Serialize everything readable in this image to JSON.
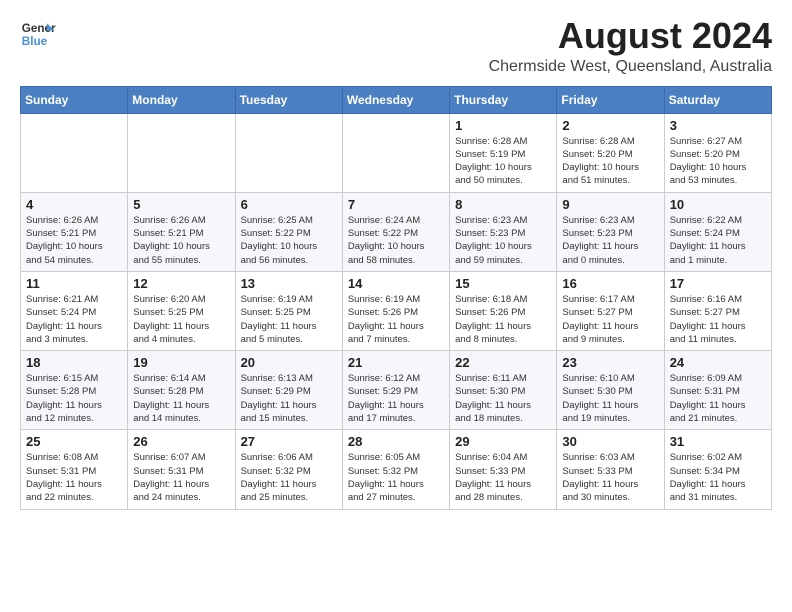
{
  "logo": {
    "line1": "General",
    "line2": "Blue"
  },
  "title": "August 2024",
  "subtitle": "Chermside West, Queensland, Australia",
  "weekdays": [
    "Sunday",
    "Monday",
    "Tuesday",
    "Wednesday",
    "Thursday",
    "Friday",
    "Saturday"
  ],
  "weeks": [
    [
      {
        "day": "",
        "info": ""
      },
      {
        "day": "",
        "info": ""
      },
      {
        "day": "",
        "info": ""
      },
      {
        "day": "",
        "info": ""
      },
      {
        "day": "1",
        "info": "Sunrise: 6:28 AM\nSunset: 5:19 PM\nDaylight: 10 hours\nand 50 minutes."
      },
      {
        "day": "2",
        "info": "Sunrise: 6:28 AM\nSunset: 5:20 PM\nDaylight: 10 hours\nand 51 minutes."
      },
      {
        "day": "3",
        "info": "Sunrise: 6:27 AM\nSunset: 5:20 PM\nDaylight: 10 hours\nand 53 minutes."
      }
    ],
    [
      {
        "day": "4",
        "info": "Sunrise: 6:26 AM\nSunset: 5:21 PM\nDaylight: 10 hours\nand 54 minutes."
      },
      {
        "day": "5",
        "info": "Sunrise: 6:26 AM\nSunset: 5:21 PM\nDaylight: 10 hours\nand 55 minutes."
      },
      {
        "day": "6",
        "info": "Sunrise: 6:25 AM\nSunset: 5:22 PM\nDaylight: 10 hours\nand 56 minutes."
      },
      {
        "day": "7",
        "info": "Sunrise: 6:24 AM\nSunset: 5:22 PM\nDaylight: 10 hours\nand 58 minutes."
      },
      {
        "day": "8",
        "info": "Sunrise: 6:23 AM\nSunset: 5:23 PM\nDaylight: 10 hours\nand 59 minutes."
      },
      {
        "day": "9",
        "info": "Sunrise: 6:23 AM\nSunset: 5:23 PM\nDaylight: 11 hours\nand 0 minutes."
      },
      {
        "day": "10",
        "info": "Sunrise: 6:22 AM\nSunset: 5:24 PM\nDaylight: 11 hours\nand 1 minute."
      }
    ],
    [
      {
        "day": "11",
        "info": "Sunrise: 6:21 AM\nSunset: 5:24 PM\nDaylight: 11 hours\nand 3 minutes."
      },
      {
        "day": "12",
        "info": "Sunrise: 6:20 AM\nSunset: 5:25 PM\nDaylight: 11 hours\nand 4 minutes."
      },
      {
        "day": "13",
        "info": "Sunrise: 6:19 AM\nSunset: 5:25 PM\nDaylight: 11 hours\nand 5 minutes."
      },
      {
        "day": "14",
        "info": "Sunrise: 6:19 AM\nSunset: 5:26 PM\nDaylight: 11 hours\nand 7 minutes."
      },
      {
        "day": "15",
        "info": "Sunrise: 6:18 AM\nSunset: 5:26 PM\nDaylight: 11 hours\nand 8 minutes."
      },
      {
        "day": "16",
        "info": "Sunrise: 6:17 AM\nSunset: 5:27 PM\nDaylight: 11 hours\nand 9 minutes."
      },
      {
        "day": "17",
        "info": "Sunrise: 6:16 AM\nSunset: 5:27 PM\nDaylight: 11 hours\nand 11 minutes."
      }
    ],
    [
      {
        "day": "18",
        "info": "Sunrise: 6:15 AM\nSunset: 5:28 PM\nDaylight: 11 hours\nand 12 minutes."
      },
      {
        "day": "19",
        "info": "Sunrise: 6:14 AM\nSunset: 5:28 PM\nDaylight: 11 hours\nand 14 minutes."
      },
      {
        "day": "20",
        "info": "Sunrise: 6:13 AM\nSunset: 5:29 PM\nDaylight: 11 hours\nand 15 minutes."
      },
      {
        "day": "21",
        "info": "Sunrise: 6:12 AM\nSunset: 5:29 PM\nDaylight: 11 hours\nand 17 minutes."
      },
      {
        "day": "22",
        "info": "Sunrise: 6:11 AM\nSunset: 5:30 PM\nDaylight: 11 hours\nand 18 minutes."
      },
      {
        "day": "23",
        "info": "Sunrise: 6:10 AM\nSunset: 5:30 PM\nDaylight: 11 hours\nand 19 minutes."
      },
      {
        "day": "24",
        "info": "Sunrise: 6:09 AM\nSunset: 5:31 PM\nDaylight: 11 hours\nand 21 minutes."
      }
    ],
    [
      {
        "day": "25",
        "info": "Sunrise: 6:08 AM\nSunset: 5:31 PM\nDaylight: 11 hours\nand 22 minutes."
      },
      {
        "day": "26",
        "info": "Sunrise: 6:07 AM\nSunset: 5:31 PM\nDaylight: 11 hours\nand 24 minutes."
      },
      {
        "day": "27",
        "info": "Sunrise: 6:06 AM\nSunset: 5:32 PM\nDaylight: 11 hours\nand 25 minutes."
      },
      {
        "day": "28",
        "info": "Sunrise: 6:05 AM\nSunset: 5:32 PM\nDaylight: 11 hours\nand 27 minutes."
      },
      {
        "day": "29",
        "info": "Sunrise: 6:04 AM\nSunset: 5:33 PM\nDaylight: 11 hours\nand 28 minutes."
      },
      {
        "day": "30",
        "info": "Sunrise: 6:03 AM\nSunset: 5:33 PM\nDaylight: 11 hours\nand 30 minutes."
      },
      {
        "day": "31",
        "info": "Sunrise: 6:02 AM\nSunset: 5:34 PM\nDaylight: 11 hours\nand 31 minutes."
      }
    ]
  ]
}
